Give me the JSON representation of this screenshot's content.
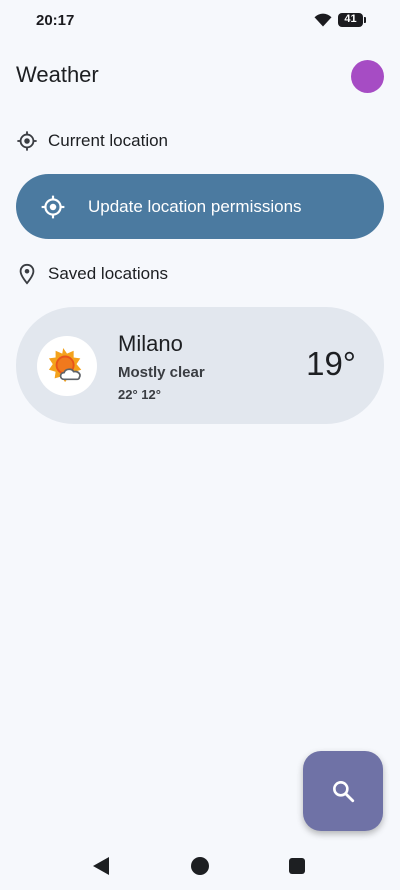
{
  "status_bar": {
    "time": "20:17",
    "battery_level": "41",
    "wifi_icon": "wifi-icon"
  },
  "app_bar": {
    "title": "Weather",
    "avatar_color": "#a64cc4"
  },
  "current_location": {
    "heading": "Current location",
    "heading_icon": "my-location-icon",
    "button_label": "Update location permissions",
    "button_icon": "my-location-icon",
    "button_color": "#4b7aa0"
  },
  "saved_locations": {
    "heading": "Saved locations",
    "heading_icon": "location-pin-icon",
    "items": [
      {
        "city": "Milano",
        "condition": "Mostly clear",
        "hi_lo": "22° 12°",
        "temperature": "19°",
        "weather_icon": "partly-cloudy-icon"
      }
    ]
  },
  "fab": {
    "icon": "search-icon",
    "color": "#6f72a6"
  },
  "nav_bar": {
    "back_icon": "back-icon",
    "home_icon": "home-icon",
    "recents_icon": "recents-icon"
  }
}
